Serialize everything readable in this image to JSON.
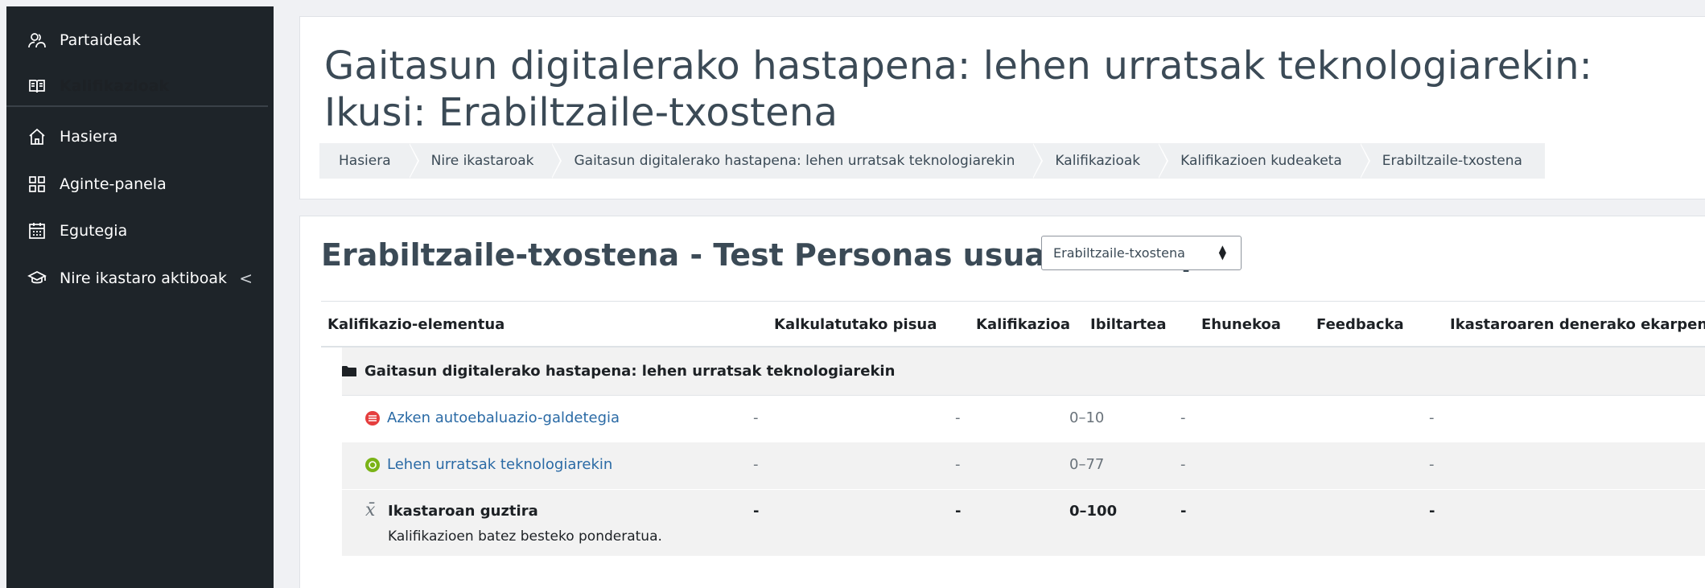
{
  "sidebar": {
    "items": [
      {
        "label": "Partaideak",
        "icon": "participants-icon"
      },
      {
        "label": "Kalifikazioak",
        "icon": "grades-book-icon"
      },
      {
        "label": "Hasiera",
        "icon": "home-icon"
      },
      {
        "label": "Aginte-panela",
        "icon": "dashboard-icon"
      },
      {
        "label": "Egutegia",
        "icon": "calendar-icon"
      },
      {
        "label": "Nire ikastaro aktiboak",
        "icon": "graduation-cap-icon"
      }
    ],
    "expand_glyph": "<"
  },
  "page": {
    "title": "Gaitasun digitalerako hastapena: lehen urratsak teknologiarekin: Ikusi: Erabiltzaile-txostena"
  },
  "breadcrumb": [
    "Hasiera",
    "Nire ikastaroak",
    "Gaitasun digitalerako hastapena: lehen urratsak teknologiarekin",
    "Kalifikazioak",
    "Kalifikazioen kudeaketa",
    "Erabiltzaile-txostena"
  ],
  "report": {
    "heading": "Erabiltzaile-txostena - Test Personas usuaria Europ",
    "select_value": "Erabiltzaile-txostena"
  },
  "table": {
    "headers": [
      "Kalifikazio-elementua",
      "Kalkulatutako pisua",
      "Kalifikazioa",
      "Ibiltartea",
      "Ehunekoa",
      "Feedbacka",
      "Ikastaroaren denerako ekarpena"
    ],
    "category": "Gaitasun digitalerako hastapena: lehen urratsak teknologiarekin",
    "rows": [
      {
        "name": "Azken autoebaluazio-galdetegia",
        "icon": "quiz-icon",
        "icon_color": "#e53e3e",
        "weight": "-",
        "grade": "-",
        "range": "0–10",
        "percent": "-",
        "contribution": "-"
      },
      {
        "name": "Lehen urratsak teknologiarekin",
        "icon": "scorm-icon",
        "icon_color": "#7ab317",
        "weight": "-",
        "grade": "-",
        "range": "0–77",
        "percent": "-",
        "contribution": "-"
      }
    ],
    "total": {
      "name": "Ikastaroan guztira",
      "subtitle": "Kalifikazioen batez besteko ponderatua.",
      "icon_glyph": "x̄",
      "weight": "-",
      "grade": "-",
      "range": "0–100",
      "percent": "-",
      "contribution": "-"
    }
  }
}
